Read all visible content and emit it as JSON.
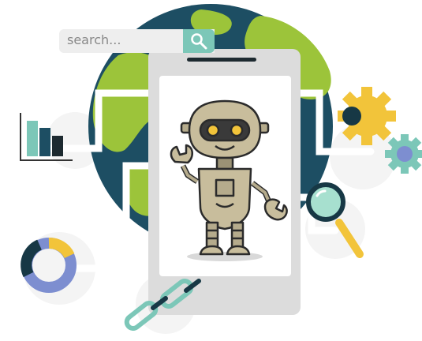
{
  "search": {
    "text": "search..."
  },
  "icons": {
    "search_button": "magnifier-icon",
    "globe": "globe-icon",
    "phone": "smartphone-icon",
    "robot": "robot-icon",
    "bar_chart": "bar-chart-icon",
    "donut_chart": "donut-chart-icon",
    "gear_large": "gear-icon",
    "gear_small": "gear-icon",
    "magnifier": "magnifying-glass-icon",
    "link": "chain-link-icon"
  },
  "colors": {
    "ocean": "#1d4e63",
    "land": "#9cc43a",
    "phone_body": "#dcdcdc",
    "robot_body": "#c8bd9c",
    "teal": "#7cc7b8",
    "gold": "#f2c43a",
    "lavender": "#7d8ed0",
    "dark_navy": "#173845"
  }
}
